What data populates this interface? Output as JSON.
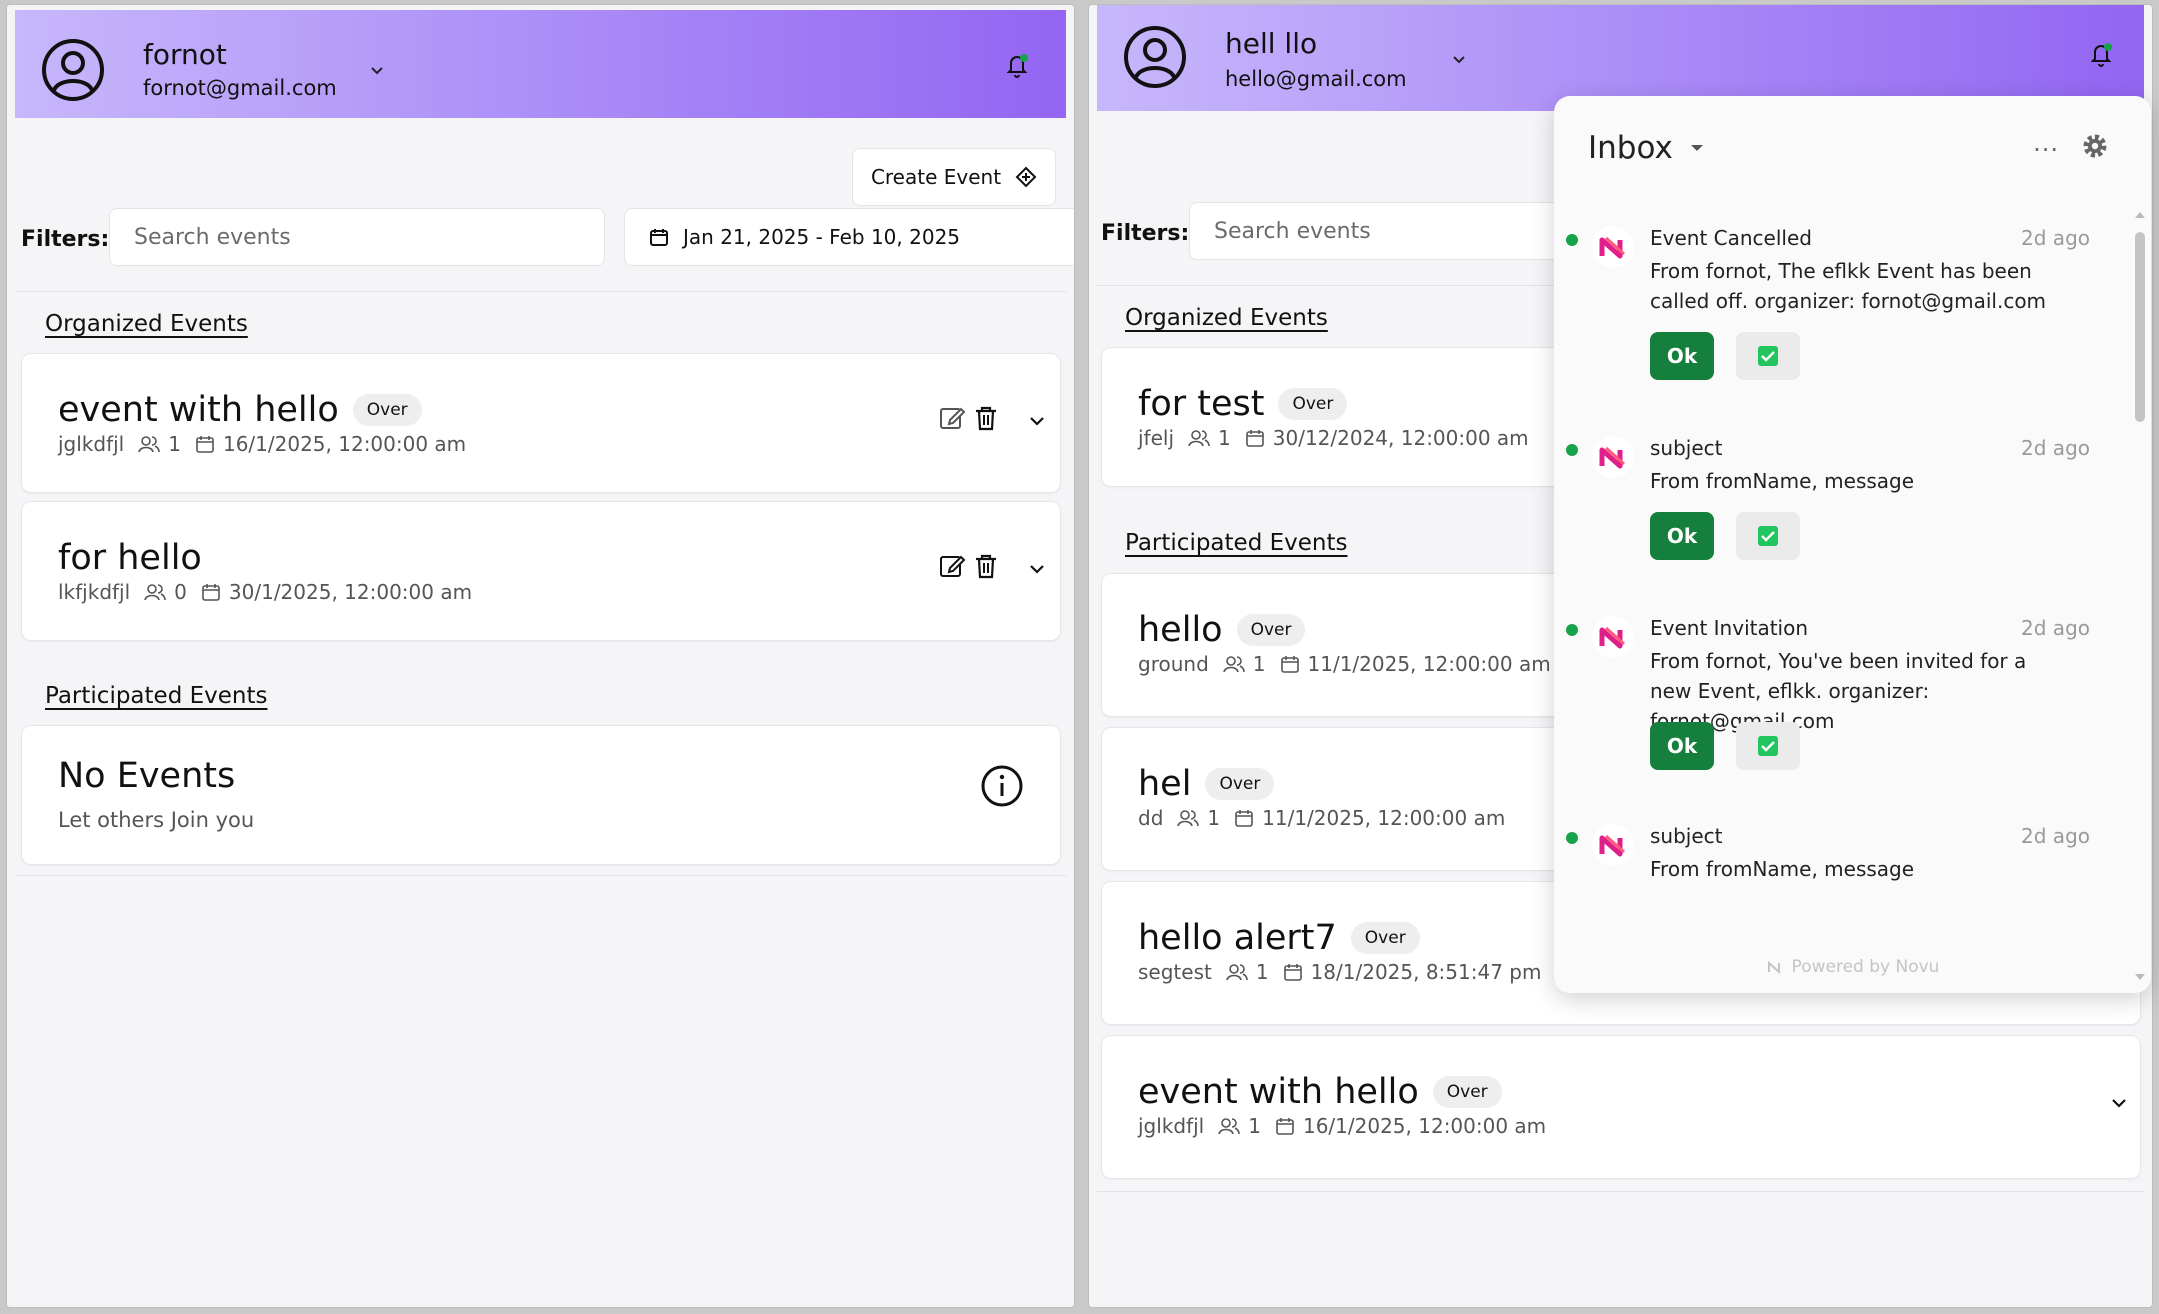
{
  "left": {
    "user": {
      "name": "fornot",
      "email": "fornot@gmail.com"
    },
    "create_event_label": "Create Event",
    "filters_label": "Filters:",
    "search_placeholder": "Search events",
    "date_range": "Jan 21, 2025 - Feb 10, 2025",
    "organized_title": "Organized Events",
    "participated_title": "Participated Events",
    "organized": [
      {
        "title": "event with hello",
        "badge": "Over",
        "subtitle": "jglkdfjl",
        "count": "1",
        "date": "16/1/2025, 12:00:00 am"
      },
      {
        "title": "for hello",
        "badge": "",
        "subtitle": "lkfjkdfjl",
        "count": "0",
        "date": "30/1/2025, 12:00:00 am"
      }
    ],
    "no_events": {
      "title": "No Events",
      "subtitle": "Let others Join you"
    }
  },
  "right": {
    "user": {
      "name": "hell llo",
      "email": "hello@gmail.com"
    },
    "filters_label": "Filters:",
    "search_placeholder": "Search events",
    "organized_title": "Organized Events",
    "participated_title": "Participated Events",
    "organized": [
      {
        "title": "for test",
        "badge": "Over",
        "subtitle": "jfelj",
        "count": "1",
        "date": "30/12/2024, 12:00:00 am"
      }
    ],
    "participated": [
      {
        "title": "hello",
        "badge": "Over",
        "subtitle": "ground",
        "count": "1",
        "date": "11/1/2025, 12:00:00 am"
      },
      {
        "title": "hel",
        "badge": "Over",
        "subtitle": "dd",
        "count": "1",
        "date": "11/1/2025, 12:00:00 am"
      },
      {
        "title": "hello alert7",
        "badge": "Over",
        "subtitle": "segtest",
        "count": "1",
        "date": "18/1/2025, 8:51:47 pm"
      },
      {
        "title": "event with hello",
        "badge": "Over",
        "subtitle": "jglkdfjl",
        "count": "1",
        "date": "16/1/2025, 12:00:00 am"
      }
    ]
  },
  "inbox": {
    "title": "Inbox",
    "more": "···",
    "powered_by": "Powered by Novu",
    "ok_label": "Ok",
    "notifications": [
      {
        "title": "Event Cancelled",
        "time": "2d ago",
        "body": "From fornot, The eflkk Event has been called off. organizer: fornot@gmail.com"
      },
      {
        "title": "subject",
        "time": "2d ago",
        "body": "From fromName, message"
      },
      {
        "title": "Event Invitation",
        "time": "2d ago",
        "body": "From fornot, You've been invited for a new Event, eflkk. organizer: fornot@gmail.com"
      },
      {
        "title": "subject",
        "time": "2d ago",
        "body": "From fromName, message"
      }
    ]
  },
  "colors": {
    "header_start": "#c7b7fb",
    "header_end": "#9365f2",
    "ok_button": "#15803d",
    "unread_dot": "#16a34a",
    "checkbox": "#22c55e"
  }
}
